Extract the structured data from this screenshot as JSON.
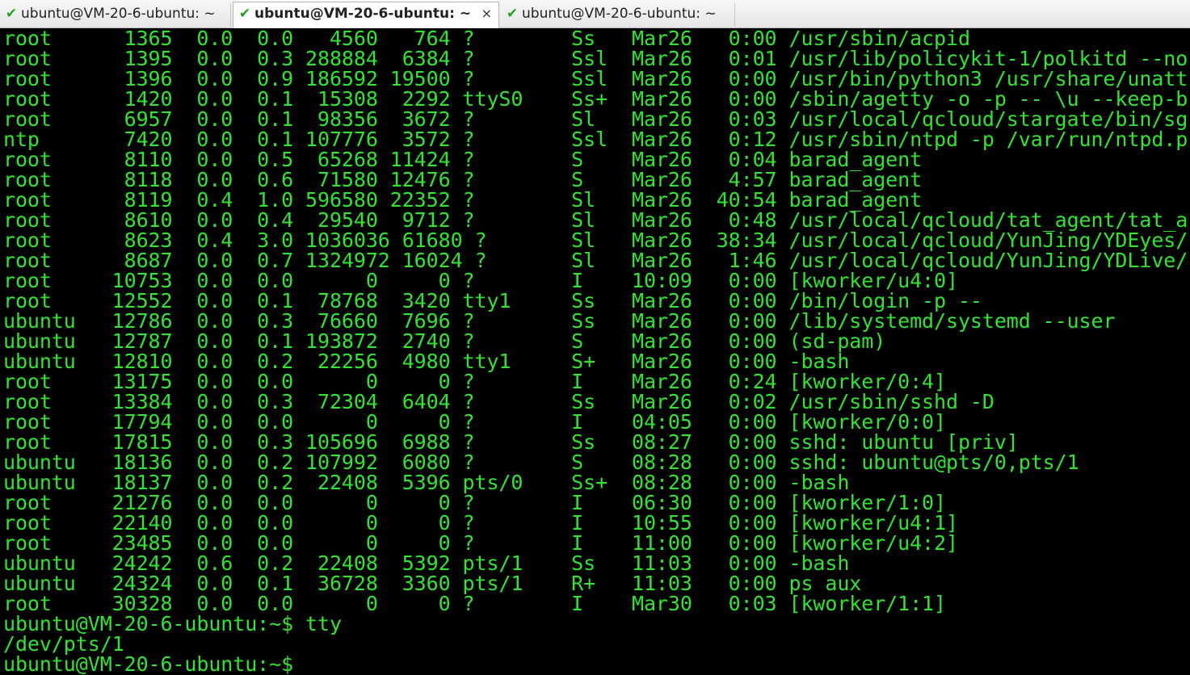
{
  "colors": {
    "terminal_text": "#2fe52f",
    "terminal_bg": "#000000",
    "tab_check": "#1fa31f"
  },
  "tabs": [
    {
      "label": "ubuntu@VM-20-6-ubuntu: ~",
      "icon": "check-icon",
      "active": false
    },
    {
      "label": "ubuntu@VM-20-6-ubuntu: ~",
      "icon": "check-icon",
      "active": true,
      "close": "×"
    },
    {
      "label": "ubuntu@VM-20-6-ubuntu: ~",
      "icon": "check-icon",
      "active": false
    }
  ],
  "terminal": {
    "ps_rows": [
      "root      1365  0.0  0.0   4560   764 ?        Ss   Mar26   0:00 /usr/sbin/acpid",
      "root      1395  0.0  0.3 288884  6384 ?        Ssl  Mar26   0:01 /usr/lib/policykit-1/polkitd --no",
      "root      1396  0.0  0.9 186592 19500 ?        Ssl  Mar26   0:00 /usr/bin/python3 /usr/share/unatt",
      "root      1420  0.0  0.1  15308  2292 ttyS0    Ss+  Mar26   0:00 /sbin/agetty -o -p -- \\u --keep-b",
      "root      6957  0.0  0.1  98356  3672 ?        Sl   Mar26   0:03 /usr/local/qcloud/stargate/bin/sg",
      "ntp       7420  0.0  0.1 107776  3572 ?        Ssl  Mar26   0:12 /usr/sbin/ntpd -p /var/run/ntpd.p",
      "root      8110  0.0  0.5  65268 11424 ?        S    Mar26   0:04 barad_agent",
      "root      8118  0.0  0.6  71580 12476 ?        S    Mar26   4:57 barad_agent",
      "root      8119  0.4  1.0 596580 22352 ?        Sl   Mar26  40:54 barad_agent",
      "root      8610  0.0  0.4  29540  9712 ?        Sl   Mar26   0:48 /usr/local/qcloud/tat_agent/tat_a",
      "root      8623  0.4  3.0 1036036 61680 ?       Sl   Mar26  38:34 /usr/local/qcloud/YunJing/YDEyes/",
      "root      8687  0.0  0.7 1324972 16024 ?       Sl   Mar26   1:46 /usr/local/qcloud/YunJing/YDLive/",
      "root     10753  0.0  0.0      0     0 ?        I    10:09   0:00 [kworker/u4:0]",
      "root     12552  0.0  0.1  78768  3420 tty1     Ss   Mar26   0:00 /bin/login -p --",
      "ubuntu   12786  0.0  0.3  76660  7696 ?        Ss   Mar26   0:00 /lib/systemd/systemd --user",
      "ubuntu   12787  0.0  0.1 193872  2740 ?        S    Mar26   0:00 (sd-pam)",
      "ubuntu   12810  0.0  0.2  22256  4980 tty1     S+   Mar26   0:00 -bash",
      "root     13175  0.0  0.0      0     0 ?        I    Mar26   0:24 [kworker/0:4]",
      "root     13384  0.0  0.3  72304  6404 ?        Ss   Mar26   0:02 /usr/sbin/sshd -D",
      "root     17794  0.0  0.0      0     0 ?        I    04:05   0:00 [kworker/0:0]",
      "root     17815  0.0  0.3 105696  6988 ?        Ss   08:27   0:00 sshd: ubuntu [priv]",
      "ubuntu   18136  0.0  0.2 107992  6080 ?        S    08:28   0:00 sshd: ubuntu@pts/0,pts/1",
      "ubuntu   18137  0.0  0.2  22408  5396 pts/0    Ss+  08:28   0:00 -bash",
      "root     21276  0.0  0.0      0     0 ?        I    06:30   0:00 [kworker/1:0]",
      "root     22140  0.0  0.0      0     0 ?        I    10:55   0:00 [kworker/u4:1]",
      "root     23485  0.0  0.0      0     0 ?        I    11:00   0:00 [kworker/u4:2]",
      "ubuntu   24242  0.6  0.2  22408  5392 pts/1    Ss   11:03   0:00 -bash",
      "ubuntu   24324  0.0  0.1  36728  3360 pts/1    R+   11:03   0:00 ps aux",
      "root     30328  0.0  0.0      0     0 ?        I    Mar30   0:03 [kworker/1:1]"
    ],
    "tty_prompt": "ubuntu@VM-20-6-ubuntu:~$ tty",
    "tty_output": "/dev/pts/1",
    "final_prompt": "ubuntu@VM-20-6-ubuntu:~$"
  }
}
